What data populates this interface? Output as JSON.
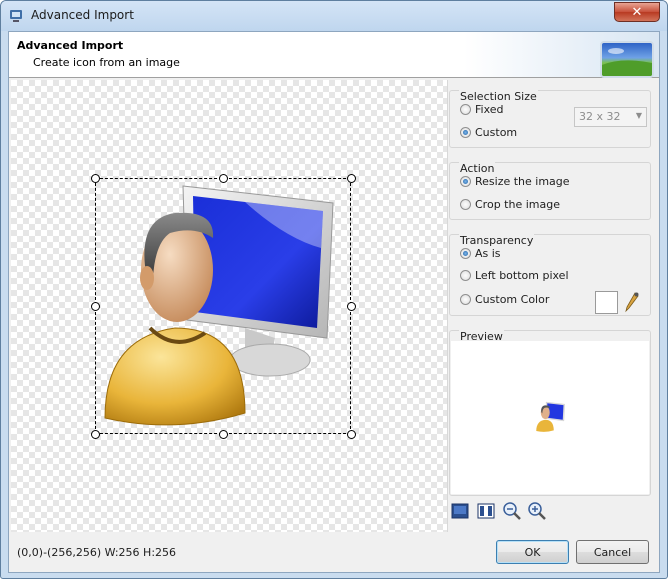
{
  "window": {
    "title": "Advanced Import",
    "close_glyph": "✕"
  },
  "header": {
    "title": "Advanced Import",
    "subtitle": "Create icon from an image"
  },
  "selection_size": {
    "label": "Selection Size",
    "options": [
      {
        "label": "Fixed",
        "checked": false
      },
      {
        "label": "Custom",
        "checked": true
      }
    ],
    "size_value": "32 x 32"
  },
  "action": {
    "label": "Action",
    "options": [
      {
        "label": "Resize the image",
        "checked": true
      },
      {
        "label": "Crop the image",
        "checked": false
      }
    ]
  },
  "transparency": {
    "label": "Transparency",
    "options": [
      {
        "label": "As is",
        "checked": true
      },
      {
        "label": "Left bottom pixel",
        "checked": false
      },
      {
        "label": "Custom Color",
        "checked": false
      }
    ],
    "custom_color": "#ffffff"
  },
  "preview": {
    "label": "Preview"
  },
  "toolbar": {
    "icons": [
      "fit-icon",
      "actual-size-icon",
      "zoom-out-icon",
      "zoom-in-icon"
    ]
  },
  "status": {
    "text": "(0,0)-(256,256) W:256 H:256"
  },
  "buttons": {
    "ok": "OK",
    "cancel": "Cancel"
  }
}
